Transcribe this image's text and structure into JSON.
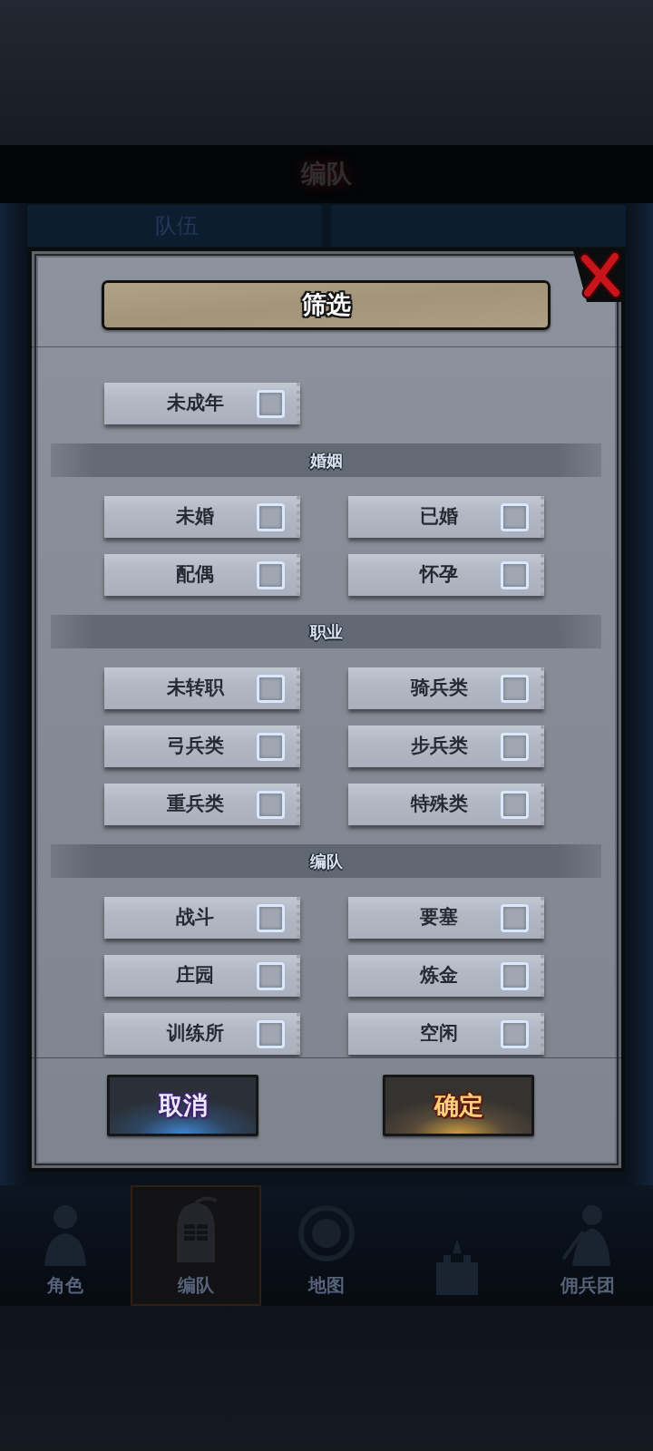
{
  "background": {
    "title": "编队",
    "tabs": [
      {
        "label": "队伍"
      }
    ],
    "nav": [
      {
        "label": "角色",
        "selected": false
      },
      {
        "label": "编队",
        "selected": true
      },
      {
        "label": "地图",
        "selected": false
      },
      {
        "selected": false
      },
      {
        "label": "佣兵团",
        "selected": false
      }
    ]
  },
  "dialog": {
    "title": "筛选",
    "sections": [
      {
        "options": [
          {
            "label": "未成年",
            "checked": false
          }
        ]
      },
      {
        "title": "婚姻",
        "options": [
          {
            "label": "未婚",
            "checked": false
          },
          {
            "label": "已婚",
            "checked": false
          },
          {
            "label": "配偶",
            "checked": false
          },
          {
            "label": "怀孕",
            "checked": false
          }
        ]
      },
      {
        "title": "职业",
        "options": [
          {
            "label": "未转职",
            "checked": false
          },
          {
            "label": "骑兵类",
            "checked": false
          },
          {
            "label": "弓兵类",
            "checked": false
          },
          {
            "label": "步兵类",
            "checked": false
          },
          {
            "label": "重兵类",
            "checked": false
          },
          {
            "label": "特殊类",
            "checked": false
          }
        ]
      },
      {
        "title": "编队",
        "options": [
          {
            "label": "战斗",
            "checked": false
          },
          {
            "label": "要塞",
            "checked": false
          },
          {
            "label": "庄园",
            "checked": false
          },
          {
            "label": "炼金",
            "checked": false
          },
          {
            "label": "训练所",
            "checked": false
          },
          {
            "label": "空闲",
            "checked": false
          }
        ]
      }
    ],
    "buttons": [
      {
        "label": "取消",
        "kind": "cancel"
      },
      {
        "label": "确定",
        "kind": "confirm"
      }
    ]
  }
}
